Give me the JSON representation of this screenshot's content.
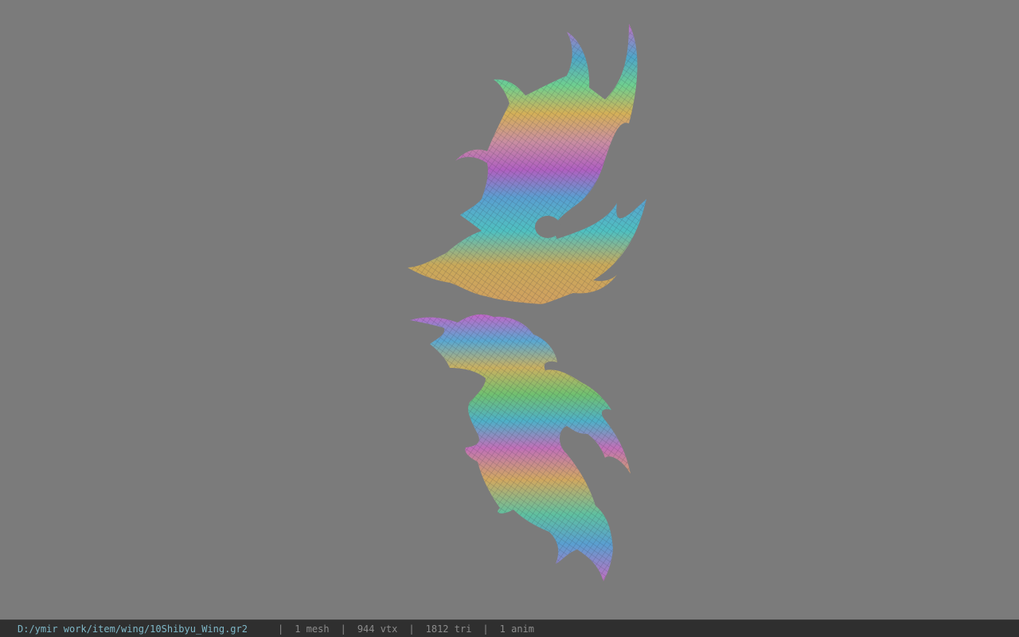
{
  "viewport": {
    "background": "#7b7b7b",
    "model_icon": "wing-mesh-icon"
  },
  "statusbar": {
    "file_path": "D:/ymir work/item/wing/10Shibyu_Wing.gr2",
    "separator": "|",
    "mesh_count": "1 mesh",
    "vertex_count": "944 vtx",
    "triangle_count": "1812 tri",
    "anim_count": "1 anim",
    "path_color": "#7fb8c8"
  }
}
